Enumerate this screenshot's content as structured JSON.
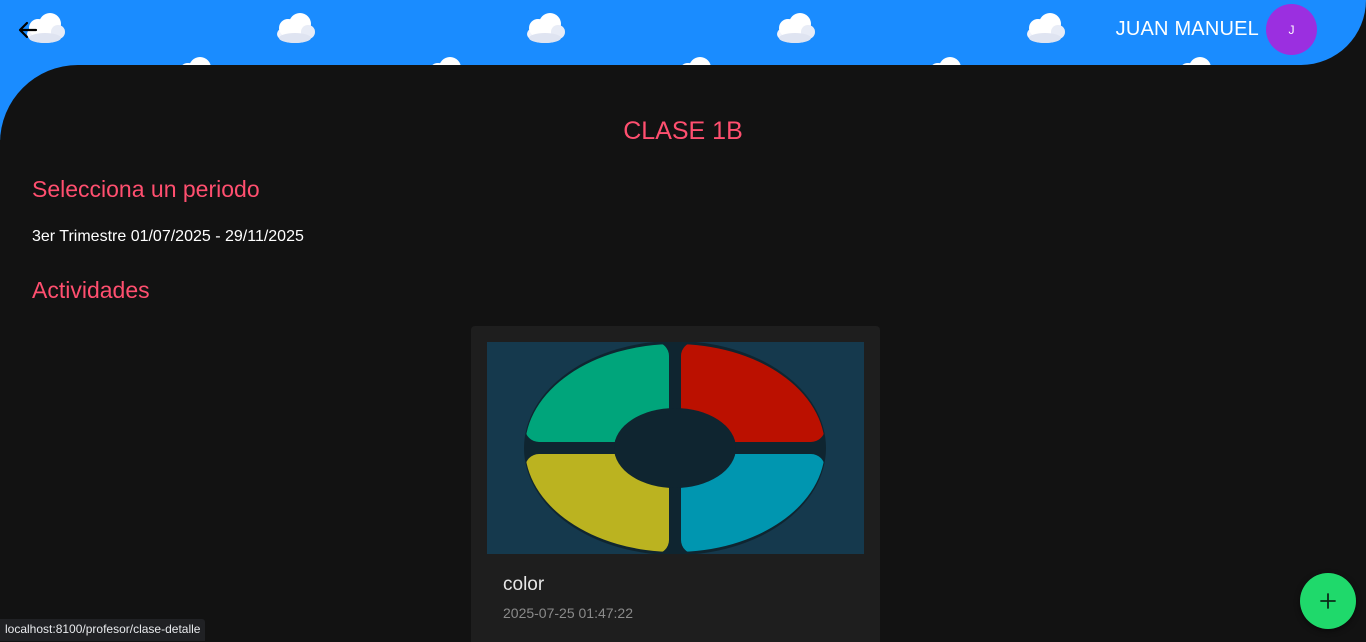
{
  "header": {
    "back_icon": "arrow-left-icon",
    "user_name": "JUAN MANUEL",
    "avatar_initial": "J",
    "colors": {
      "band": "#1a8cff",
      "avatar": "#9b2fe0"
    }
  },
  "main": {
    "title": "CLASE 1B",
    "period_heading": "Selecciona un periodo",
    "period_value": "3er Trimestre 01/07/2025 - 29/11/2025",
    "activities_heading": "Actividades",
    "accent_color": "#ff4f6f"
  },
  "activities": [
    {
      "title": "color",
      "date": "2025-07-25 01:47:22",
      "image_icon": "simon-game-icon"
    }
  ],
  "fab": {
    "icon": "plus-icon",
    "color": "#1fd96b"
  },
  "status_bar": {
    "url": "localhost:8100/profesor/clase-detalle"
  }
}
